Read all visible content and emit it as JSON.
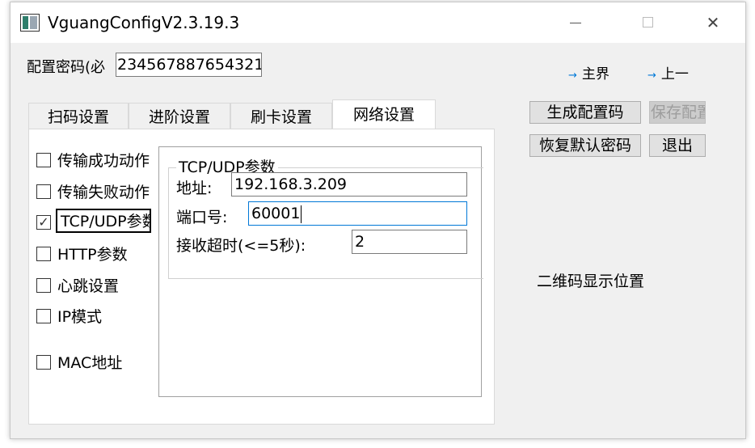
{
  "window": {
    "title": "VguangConfigV2.3.19.3",
    "minimize_glyph": "",
    "close_glyph": "✕"
  },
  "header": {
    "password_label": "配置密码(必",
    "password_value": "234567887654321",
    "nav_main": "主界",
    "nav_prev": "上一"
  },
  "tabs": [
    {
      "label": "扫码设置"
    },
    {
      "label": "进阶设置"
    },
    {
      "label": "刷卡设置"
    },
    {
      "label": "网络设置",
      "active": true
    }
  ],
  "checkboxes": [
    {
      "label": "传输成功动作",
      "checked": false
    },
    {
      "label": "传输失败动作",
      "checked": false
    },
    {
      "label": "TCP/UDP参数",
      "checked": true
    },
    {
      "label": "HTTP参数",
      "checked": false
    },
    {
      "label": "心跳设置",
      "checked": false
    },
    {
      "label": "IP模式",
      "checked": false
    },
    {
      "label": "MAC地址",
      "checked": false
    }
  ],
  "tcp_udp": {
    "group_title": "TCP/UDP参数",
    "address_label": "地址:",
    "address_value": "192.168.3.209",
    "port_label": "端口号:",
    "port_value": "60001",
    "timeout_label": "接收超时(<=5秒):",
    "timeout_value": "2"
  },
  "buttons": {
    "generate": "生成配置码",
    "save": "保存配置",
    "restore": "恢复默认密码",
    "exit": "退出"
  },
  "qr_placeholder": "二维码显示位置",
  "icons": {
    "check": "✓",
    "arrow": "→"
  },
  "colors": {
    "accent": "#0078d7",
    "window_bg": "#f0f0f0",
    "panel_bg": "#ffffff"
  }
}
